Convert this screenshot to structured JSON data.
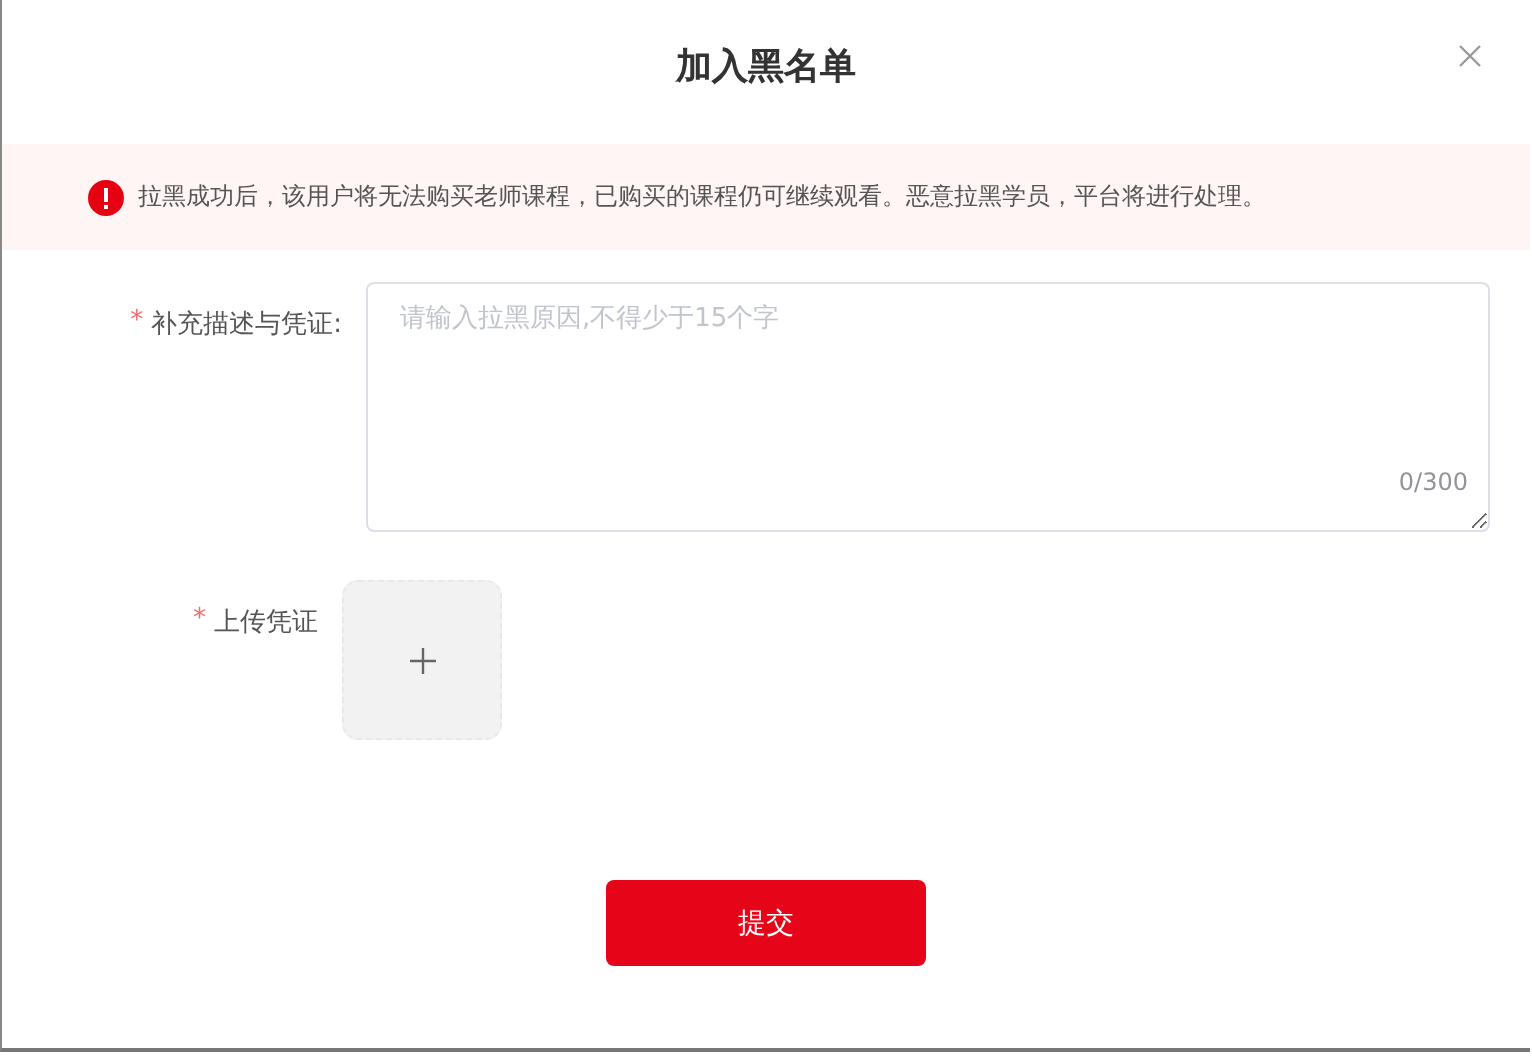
{
  "dialog": {
    "title": "加入黑名单"
  },
  "alert": {
    "text": "拉黑成功后，该用户将无法购买老师课程，已购买的课程仍可继续观看。恶意拉黑学员，平台将进行处理。"
  },
  "fields": [
    {
      "kind": "textarea",
      "required_mark": "*",
      "label": "补充描述与凭证:",
      "placeholder": "请输入拉黑原因,不得少于15个字",
      "counter": "0/300"
    },
    {
      "kind": "upload",
      "required_mark": "*",
      "label": "上传凭证"
    }
  ],
  "submit": "提交"
}
